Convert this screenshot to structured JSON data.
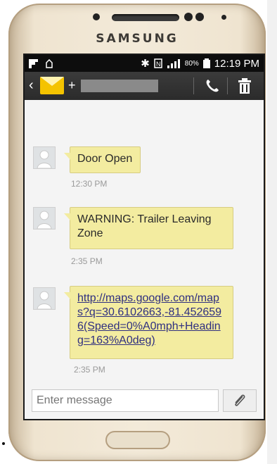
{
  "device": {
    "brand": "SAMSUNG"
  },
  "status_bar": {
    "battery": "80%",
    "time": "12:19 PM"
  },
  "header": {
    "contact_prefix": "+"
  },
  "messages": [
    {
      "text": "Door Open",
      "time": "12:30 PM",
      "is_link": false
    },
    {
      "text": "WARNING: Trailer Leaving Zone",
      "time": "2:35 PM",
      "is_link": false
    },
    {
      "text": "http://maps.google.com/maps?q=30.6102663,-81.4526596(Speed=0%A0mph+Heading=163%A0deg)",
      "time": "2:35 PM",
      "is_link": true
    }
  ],
  "composer": {
    "placeholder": "Enter message"
  },
  "icons": [
    "back-icon",
    "mail-icon",
    "call-icon",
    "trash-icon",
    "paperclip-icon",
    "bluetooth-icon",
    "nfc-icon",
    "signal-icon",
    "battery-icon"
  ],
  "colors": {
    "bubble": "#f3eca0",
    "mail_icon": "#f4c300",
    "link": "#2f2f80"
  }
}
